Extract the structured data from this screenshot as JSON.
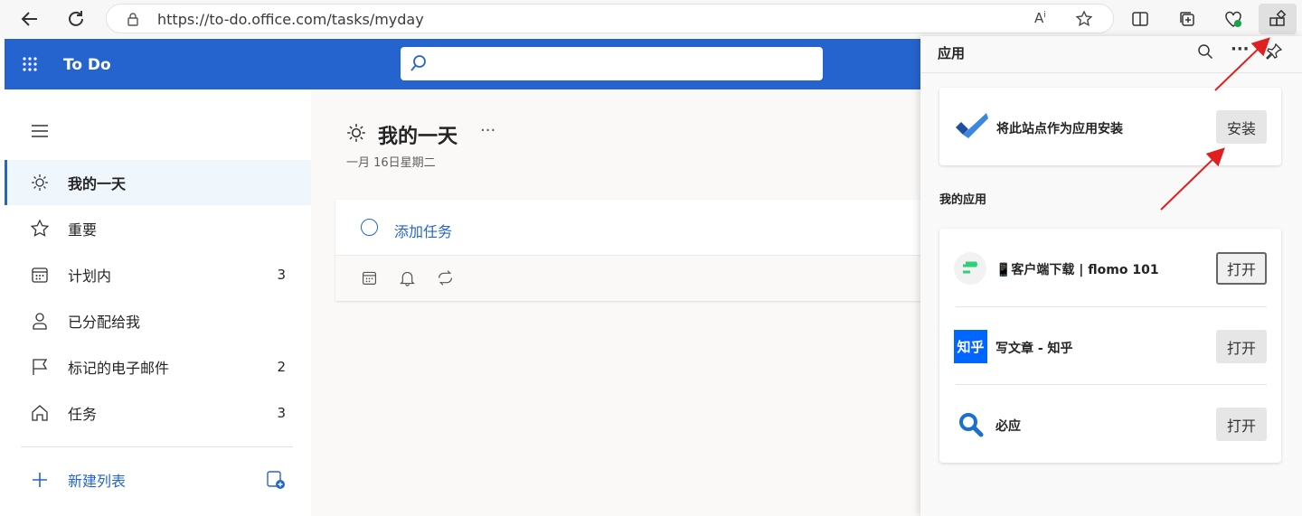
{
  "browser": {
    "url": "https://to-do.office.com/tasks/myday"
  },
  "app": {
    "title": "To Do",
    "search_placeholder": ""
  },
  "sidebar": {
    "items": [
      {
        "label": "我的一天",
        "count": "",
        "icon": "sun-icon",
        "selected": true
      },
      {
        "label": "重要",
        "count": "",
        "icon": "star-icon"
      },
      {
        "label": "计划内",
        "count": "3",
        "icon": "calendar-icon"
      },
      {
        "label": "已分配给我",
        "count": "",
        "icon": "person-icon"
      },
      {
        "label": "标记的电子邮件",
        "count": "2",
        "icon": "flag-icon"
      },
      {
        "label": "任务",
        "count": "3",
        "icon": "home-icon"
      }
    ],
    "new_list_label": "新建列表"
  },
  "main": {
    "title": "我的一天",
    "date": "一月 16日星期二",
    "add_task_label": "添加任务"
  },
  "apps_panel": {
    "title": "应用",
    "install_text": "将此站点作为应用安装",
    "install_button": "安装",
    "my_apps_heading": "我的应用",
    "apps": [
      {
        "name": "📱客户端下载 | flomo 101",
        "button": "打开",
        "icon": "flomo-icon"
      },
      {
        "name": "写文章 - 知乎",
        "button": "打开",
        "icon": "zhihu-icon",
        "icon_text": "知乎"
      },
      {
        "name": "必应",
        "button": "打开",
        "icon": "bing-search-icon"
      }
    ]
  },
  "colors": {
    "accent": "#2564cf",
    "annotation_arrow": "#e02020"
  }
}
